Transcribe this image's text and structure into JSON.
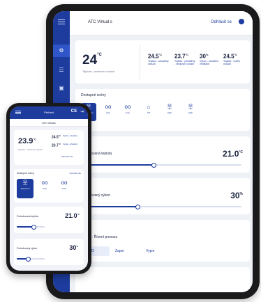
{
  "tablet": {
    "header": {
      "title": "ATC Virtual s",
      "logout": "Odhlásit se"
    },
    "temperature": {
      "value": "24",
      "unit": "°C",
      "label": "Teplota - venkovní vzduch"
    },
    "tiles": [
      {
        "value": "24.5",
        "unit": "°C",
        "label": "Teplota - odváděný vzduch"
      },
      {
        "value": "23.7",
        "unit": "°C",
        "label": "Teplota - přiváděný - venkovní vzduch"
      },
      {
        "value": "30",
        "unit": "%",
        "label": "Výkon - přiváděcí ventilátor"
      },
      {
        "value": "24.5",
        "unit": "°C",
        "label": "Teplota - vnitřní vzduch"
      }
    ],
    "scenes_title": "Dostupné scény",
    "scenes": [
      {
        "icon": "person-walking-icon",
        "glyph": "웃",
        "label": "Intenzivní"
      },
      {
        "icon": "glasses-icon",
        "glyph": "oo",
        "label": "Auto"
      },
      {
        "icon": "glasses-icon",
        "glyph": "oo",
        "label": "Auto"
      },
      {
        "icon": "home-icon",
        "glyph": "⌂",
        "label": "Off"
      },
      {
        "icon": "person-walking-icon",
        "glyph": "웃",
        "label": "High"
      },
      {
        "icon": "person-walking-icon",
        "glyph": "웃",
        "label": "High"
      }
    ],
    "requested_temp": {
      "label": "Požadovaná teplota",
      "value": "21.0",
      "unit": "°C",
      "level": 0.45
    },
    "requested_power": {
      "label": "Požadovaný výkon",
      "value": "30",
      "unit": "%",
      "level": 0.35
    },
    "mode": {
      "label": "Režim - Řízení provozu",
      "buttons": [
        "AUTO",
        "Zapni",
        "Vypni"
      ]
    }
  },
  "phone": {
    "header": {
      "title": "Přehled",
      "user": "CS"
    },
    "subtitle": "ATC Virtuals",
    "temperature": {
      "value": "23.9",
      "unit": "°C",
      "label": "Teplota - venkovní vzduch"
    },
    "tiles": [
      {
        "value": "24.5",
        "unit": "°C",
        "label": "Teplota - odváděný"
      },
      {
        "value": "23.7",
        "unit": "°C",
        "label": "Teplota - přiváděný"
      }
    ],
    "more_label": "Zobrazit vše",
    "scenes_title": "Dostupné scény",
    "scenes_link": "Zobrazit vše",
    "scenes": [
      {
        "icon": "person-walking-icon",
        "glyph": "웃",
        "label": "Intenzivní"
      },
      {
        "icon": "glasses-icon",
        "glyph": "oo",
        "label": "Auto"
      },
      {
        "icon": "glasses-icon",
        "glyph": "oo",
        "label": "Auto"
      }
    ],
    "requested_temp": {
      "label": "Požadovaná teplota",
      "value": "21.0",
      "unit": "°C",
      "level": 0.6
    },
    "requested_power": {
      "label": "Požadovaný výkon",
      "value": "30",
      "unit": "%",
      "level": 0.4
    }
  },
  "colors": {
    "brand": "#1d3c9d",
    "background": "#eef1f6",
    "device": "#1a1a1c"
  }
}
